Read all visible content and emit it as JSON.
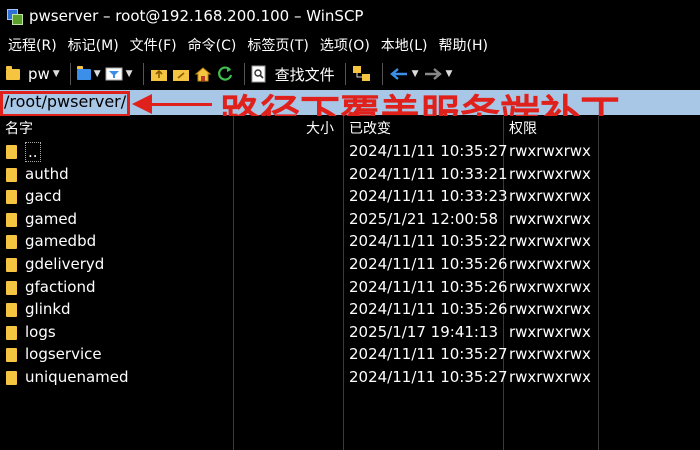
{
  "window": {
    "title": "pwserver – root@192.168.200.100 – WinSCP"
  },
  "menu": [
    "远程(R)",
    "标记(M)",
    "文件(F)",
    "命令(C)",
    "标签页(T)",
    "选项(O)",
    "本地(L)",
    "帮助(H)"
  ],
  "toolbar": {
    "folder_label": "pw",
    "find_label": "查找文件"
  },
  "path": {
    "value": "/root/pwserver/"
  },
  "annotation": {
    "text": "路径下覆盖服务端补丁",
    "color": "#e0201a"
  },
  "columns": {
    "name": "名字",
    "size": "大小",
    "changed": "已改变",
    "rights": "权限"
  },
  "files": [
    {
      "name": "..",
      "date": "2024/11/11 10:35:27",
      "perm": "rwxrwxrwx"
    },
    {
      "name": "authd",
      "date": "2024/11/11 10:33:21",
      "perm": "rwxrwxrwx"
    },
    {
      "name": "gacd",
      "date": "2024/11/11 10:33:23",
      "perm": "rwxrwxrwx"
    },
    {
      "name": "gamed",
      "date": "2025/1/21 12:00:58",
      "perm": "rwxrwxrwx"
    },
    {
      "name": "gamedbd",
      "date": "2024/11/11 10:35:22",
      "perm": "rwxrwxrwx"
    },
    {
      "name": "gdeliveryd",
      "date": "2024/11/11 10:35:26",
      "perm": "rwxrwxrwx"
    },
    {
      "name": "gfactiond",
      "date": "2024/11/11 10:35:26",
      "perm": "rwxrwxrwx"
    },
    {
      "name": "glinkd",
      "date": "2024/11/11 10:35:26",
      "perm": "rwxrwxrwx"
    },
    {
      "name": "logs",
      "date": "2025/1/17 19:41:13",
      "perm": "rwxrwxrwx"
    },
    {
      "name": "logservice",
      "date": "2024/11/11 10:35:27",
      "perm": "rwxrwxrwx"
    },
    {
      "name": "uniquenamed",
      "date": "2024/11/11 10:35:27",
      "perm": "rwxrwxrwx"
    }
  ],
  "icons": {
    "folder_color": "#f5c542",
    "path_bar_color": "#a8c6e6",
    "accent_blue": "#3b8fe8",
    "refresh_green": "#3fbf4f"
  }
}
